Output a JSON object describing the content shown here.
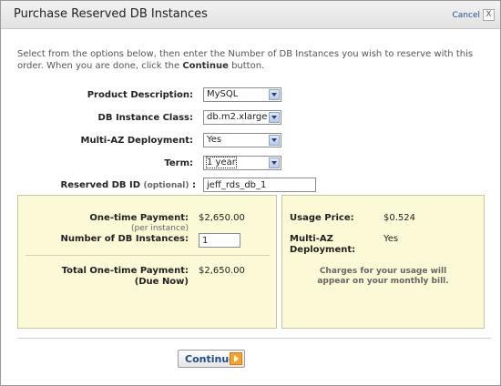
{
  "dialog": {
    "title": "Purchase Reserved DB Instances",
    "cancel_label": "Cancel",
    "close_glyph": "X"
  },
  "intro": {
    "text_before": "Select from the options below, then enter the Number of DB Instances you wish to reserve with this order. When you are done, click the ",
    "bold": "Continue",
    "text_after": " button."
  },
  "form": {
    "product_description": {
      "label": "Product Description:",
      "value": "MySQL"
    },
    "db_instance_class": {
      "label": "DB Instance Class:",
      "value": "db.m2.xlarge"
    },
    "multi_az": {
      "label": "Multi-AZ Deployment:",
      "value": "Yes"
    },
    "term": {
      "label": "Term:",
      "value": "1 year"
    },
    "reserved_db_id": {
      "label": "Reserved DB ID",
      "optional": "(optional)",
      "colon": ":",
      "value": "jeff_rds_db_1"
    }
  },
  "left_panel": {
    "one_time_label": "One-time Payment:",
    "one_time_sub": "(per instance)",
    "one_time_value": "$2,650.00",
    "num_instances_label": "Number of DB Instances:",
    "num_instances_value": "1",
    "total_label": "Total One-time Payment:",
    "total_sub": "(Due Now)",
    "total_value": "$2,650.00"
  },
  "right_panel": {
    "usage_label": "Usage Price:",
    "usage_value": "$0.524",
    "multi_az_label_1": "Multi-AZ",
    "multi_az_label_2": "Deployment:",
    "multi_az_value": "Yes",
    "note_1": "Charges for your usage will",
    "note_2": "appear on your monthly bill."
  },
  "footer": {
    "continue_label": "Continue"
  },
  "colors": {
    "panel_bg": "#fcfad6",
    "link_blue": "#1f4e8c",
    "button_accent": "#f7a22a"
  }
}
